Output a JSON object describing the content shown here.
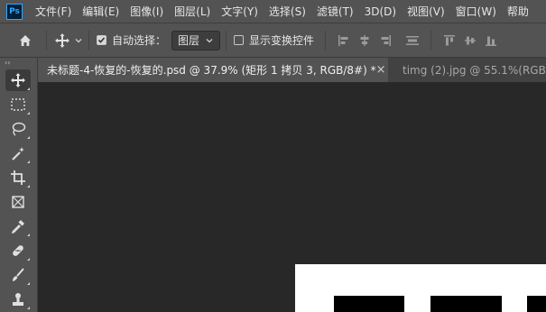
{
  "app": {
    "logo_text": "Ps"
  },
  "menu": [
    "文件(F)",
    "编辑(E)",
    "图像(I)",
    "图层(L)",
    "文字(Y)",
    "选择(S)",
    "滤镜(T)",
    "3D(D)",
    "视图(V)",
    "窗口(W)",
    "帮助"
  ],
  "options": {
    "auto_select_label": "自动选择：",
    "auto_select_checked": true,
    "auto_select_target": "图层",
    "show_transform_label": "显示变换控件",
    "show_transform_checked": false
  },
  "tabs": [
    {
      "title": "未标题-4-恢复的-恢复的.psd @ 37.9% (矩形 1 拷贝 3, RGB/8#) *",
      "close": "×",
      "active": true
    },
    {
      "title": "timg (2).jpg @ 55.1%(RGB/8#)",
      "active": false
    }
  ],
  "toolbar": {
    "grip": "››",
    "tools": [
      {
        "name": "move-tool-icon",
        "selected": true
      },
      {
        "name": "marquee-tool-icon"
      },
      {
        "name": "lasso-tool-icon"
      },
      {
        "name": "magic-wand-tool-icon"
      },
      {
        "name": "crop-tool-icon"
      },
      {
        "name": "frame-tool-icon"
      },
      {
        "name": "eyedropper-tool-icon"
      },
      {
        "name": "healing-brush-tool-icon"
      },
      {
        "name": "brush-tool-icon"
      },
      {
        "name": "stamp-tool-icon"
      }
    ]
  },
  "colors": {
    "accent": "#31a8ff",
    "panel": "#535353",
    "workspace": "#282828"
  }
}
